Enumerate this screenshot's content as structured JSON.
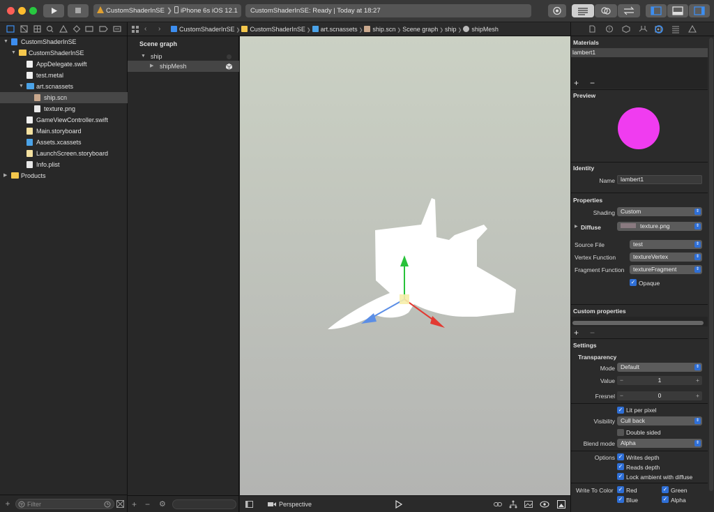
{
  "toolbar": {
    "scheme_project": "CustomShaderInSE",
    "scheme_device": "iPhone 6s iOS 12.1",
    "status_text": "CustomShaderInSE: Ready | Today at 18:27"
  },
  "navigator": {
    "items": [
      {
        "label": "CustomShaderInSE",
        "type": "project",
        "depth": 0,
        "expanded": true
      },
      {
        "label": "CustomShaderInSE",
        "type": "folder",
        "depth": 1,
        "expanded": true
      },
      {
        "label": "AppDelegate.swift",
        "type": "swift",
        "depth": 2
      },
      {
        "label": "test.metal",
        "type": "metal",
        "depth": 2
      },
      {
        "label": "art.scnassets",
        "type": "assets-folder",
        "depth": 2,
        "expanded": true
      },
      {
        "label": "ship.scn",
        "type": "scn",
        "depth": 3,
        "selected": true
      },
      {
        "label": "texture.png",
        "type": "png",
        "depth": 3
      },
      {
        "label": "GameViewController.swift",
        "type": "swift",
        "depth": 2
      },
      {
        "label": "Main.storyboard",
        "type": "storyboard",
        "depth": 2
      },
      {
        "label": "Assets.xcassets",
        "type": "assets",
        "depth": 2
      },
      {
        "label": "LaunchScreen.storyboard",
        "type": "storyboard",
        "depth": 2
      },
      {
        "label": "Info.plist",
        "type": "plist",
        "depth": 2
      },
      {
        "label": "Products",
        "type": "folder",
        "depth": 0,
        "expanded": false
      }
    ],
    "filter_placeholder": "Filter"
  },
  "breadcrumbs": [
    "CustomShaderInSE",
    "CustomShaderInSE",
    "art.scnassets",
    "ship.scn",
    "Scene graph",
    "ship",
    "shipMesh"
  ],
  "scene_graph": {
    "title": "Scene graph",
    "nodes": [
      {
        "label": "ship",
        "depth": 0
      },
      {
        "label": "shipMesh",
        "depth": 1,
        "selected": true
      }
    ]
  },
  "viewport": {
    "camera_label": "Perspective"
  },
  "inspector": {
    "materials_title": "Materials",
    "materials": [
      "lambert1"
    ],
    "preview_title": "Preview",
    "preview_color": "#f03cf0",
    "identity_title": "Identity",
    "name_label": "Name",
    "name_value": "lambert1",
    "properties_title": "Properties",
    "shading_label": "Shading",
    "shading_value": "Custom",
    "diffuse_label": "Diffuse",
    "diffuse_value": "texture.png",
    "source_file_label": "Source File",
    "source_file_value": "test",
    "vertex_function_label": "Vertex Function",
    "vertex_function_value": "textureVertex",
    "fragment_function_label": "Fragment Function",
    "fragment_function_value": "textureFragment",
    "opaque_label": "Opaque",
    "opaque_checked": true,
    "custom_properties_title": "Custom properties",
    "settings_title": "Settings",
    "transparency_title": "Transparency",
    "mode_label": "Mode",
    "mode_value": "Default",
    "value_label": "Value",
    "value_value": "1",
    "fresnel_label": "Fresnel",
    "fresnel_value": "0",
    "lit_per_pixel_label": "Lit per pixel",
    "lit_per_pixel_checked": true,
    "visibility_label": "Visibility",
    "visibility_value": "Cull back",
    "double_sided_label": "Double sided",
    "double_sided_checked": false,
    "blend_mode_label": "Blend mode",
    "blend_mode_value": "Alpha",
    "options_label": "Options",
    "writes_depth_label": "Writes depth",
    "writes_depth_checked": true,
    "reads_depth_label": "Reads depth",
    "reads_depth_checked": true,
    "lock_ambient_label": "Lock ambient with diffuse",
    "lock_ambient_checked": true,
    "write_to_color_label": "Write To Color",
    "red_label": "Red",
    "green_label": "Green",
    "blue_label": "Blue",
    "alpha_label": "Alpha"
  },
  "colors": {
    "accent": "#2f6fd6",
    "gizmo_x": "#e23a32",
    "gizmo_y": "#28c23a",
    "gizmo_z": "#5b8ee6"
  }
}
